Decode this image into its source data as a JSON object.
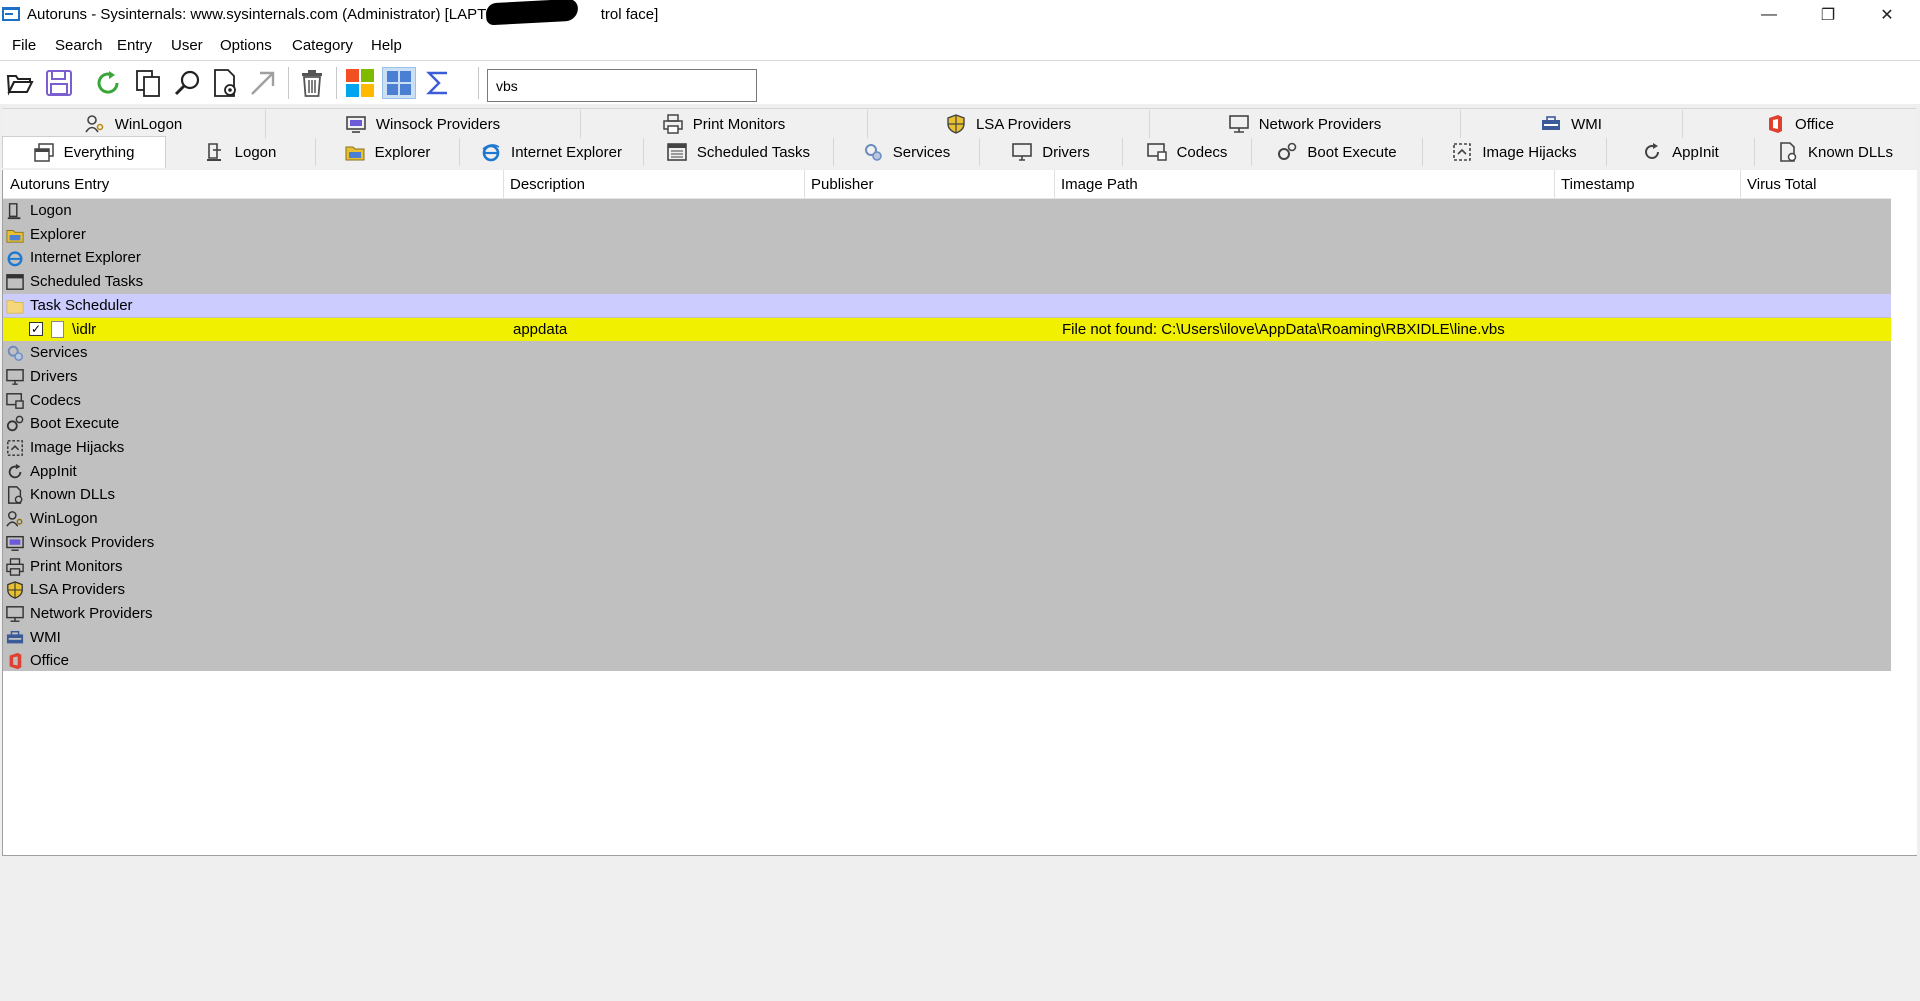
{
  "window": {
    "title": "Autoruns - Sysinternals: www.sysinternals.com (Administrator) [LAPTOP-",
    "title_suffix": "trol face]",
    "minimize_glyph": "—",
    "restore_glyph": "❐",
    "close_glyph": "✕"
  },
  "menu": {
    "items": [
      "File",
      "Search",
      "Entry",
      "User",
      "Options",
      "Category",
      "Help"
    ]
  },
  "toolbar": {
    "buttons": [
      "open-icon",
      "save-icon",
      "refresh-icon",
      "copy-icon",
      "find-icon",
      "properties-icon",
      "jump-icon",
      "delete-icon",
      "windows-logo-icon",
      "view-icon",
      "sigma-icon"
    ],
    "filter_value": "vbs"
  },
  "tabs": {
    "top": [
      {
        "label": "WinLogon",
        "icon": "winlogon-icon"
      },
      {
        "label": "Winsock Providers",
        "icon": "winsock-icon"
      },
      {
        "label": "Print Monitors",
        "icon": "printer-icon"
      },
      {
        "label": "LSA Providers",
        "icon": "shield-icon"
      },
      {
        "label": "Network Providers",
        "icon": "network-icon"
      },
      {
        "label": "WMI",
        "icon": "wmi-icon"
      },
      {
        "label": "Office",
        "icon": "office-icon"
      }
    ],
    "bottom": [
      {
        "label": "Everything",
        "icon": "everything-icon",
        "active": true
      },
      {
        "label": "Logon",
        "icon": "logon-icon"
      },
      {
        "label": "Explorer",
        "icon": "explorer-icon"
      },
      {
        "label": "Internet Explorer",
        "icon": "ie-icon"
      },
      {
        "label": "Scheduled Tasks",
        "icon": "scheduled-tasks-icon"
      },
      {
        "label": "Services",
        "icon": "services-icon"
      },
      {
        "label": "Drivers",
        "icon": "drivers-icon"
      },
      {
        "label": "Codecs",
        "icon": "codecs-icon"
      },
      {
        "label": "Boot Execute",
        "icon": "boot-execute-icon"
      },
      {
        "label": "Image Hijacks",
        "icon": "image-hijacks-icon"
      },
      {
        "label": "AppInit",
        "icon": "appinit-icon"
      },
      {
        "label": "Known DLLs",
        "icon": "known-dlls-icon"
      }
    ]
  },
  "columns": [
    "Autoruns Entry",
    "Description",
    "Publisher",
    "Image Path",
    "Timestamp",
    "Virus Total"
  ],
  "rows": [
    {
      "type": "category",
      "label": "Logon",
      "icon": "logon-icon"
    },
    {
      "type": "category",
      "label": "Explorer",
      "icon": "explorer-icon"
    },
    {
      "type": "category",
      "label": "Internet Explorer",
      "icon": "ie-icon"
    },
    {
      "type": "category",
      "label": "Scheduled Tasks",
      "icon": "scheduled-tasks-icon"
    },
    {
      "type": "category",
      "label": "Task Scheduler",
      "icon": "folder-icon",
      "selected": true
    },
    {
      "type": "entry",
      "label": "\\idlr",
      "checked": true,
      "description": "appdata",
      "publisher": "",
      "image_path": "File not found: C:\\Users\\ilove\\AppData\\Roaming\\RBXIDLE\\line.vbs",
      "timestamp": "",
      "virus_total": ""
    },
    {
      "type": "category",
      "label": "Services",
      "icon": "services-icon"
    },
    {
      "type": "category",
      "label": "Drivers",
      "icon": "drivers-icon"
    },
    {
      "type": "category",
      "label": "Codecs",
      "icon": "codecs-icon"
    },
    {
      "type": "category",
      "label": "Boot Execute",
      "icon": "boot-execute-icon"
    },
    {
      "type": "category",
      "label": "Image Hijacks",
      "icon": "image-hijacks-icon"
    },
    {
      "type": "category",
      "label": "AppInit",
      "icon": "appinit-icon"
    },
    {
      "type": "category",
      "label": "Known DLLs",
      "icon": "known-dlls-icon"
    },
    {
      "type": "category",
      "label": "WinLogon",
      "icon": "winlogon-icon"
    },
    {
      "type": "category",
      "label": "Winsock Providers",
      "icon": "winsock-icon"
    },
    {
      "type": "category",
      "label": "Print Monitors",
      "icon": "printer-icon"
    },
    {
      "type": "category",
      "label": "LSA Providers",
      "icon": "shield-icon"
    },
    {
      "type": "category",
      "label": "Network Providers",
      "icon": "network-icon"
    },
    {
      "type": "category",
      "label": "WMI",
      "icon": "wmi-icon"
    },
    {
      "type": "category",
      "label": "Office",
      "icon": "office-icon"
    }
  ],
  "colors": {
    "selected_row": "#ccccff",
    "found_row": "#f0f000",
    "category_row": "#c0c0c0"
  }
}
